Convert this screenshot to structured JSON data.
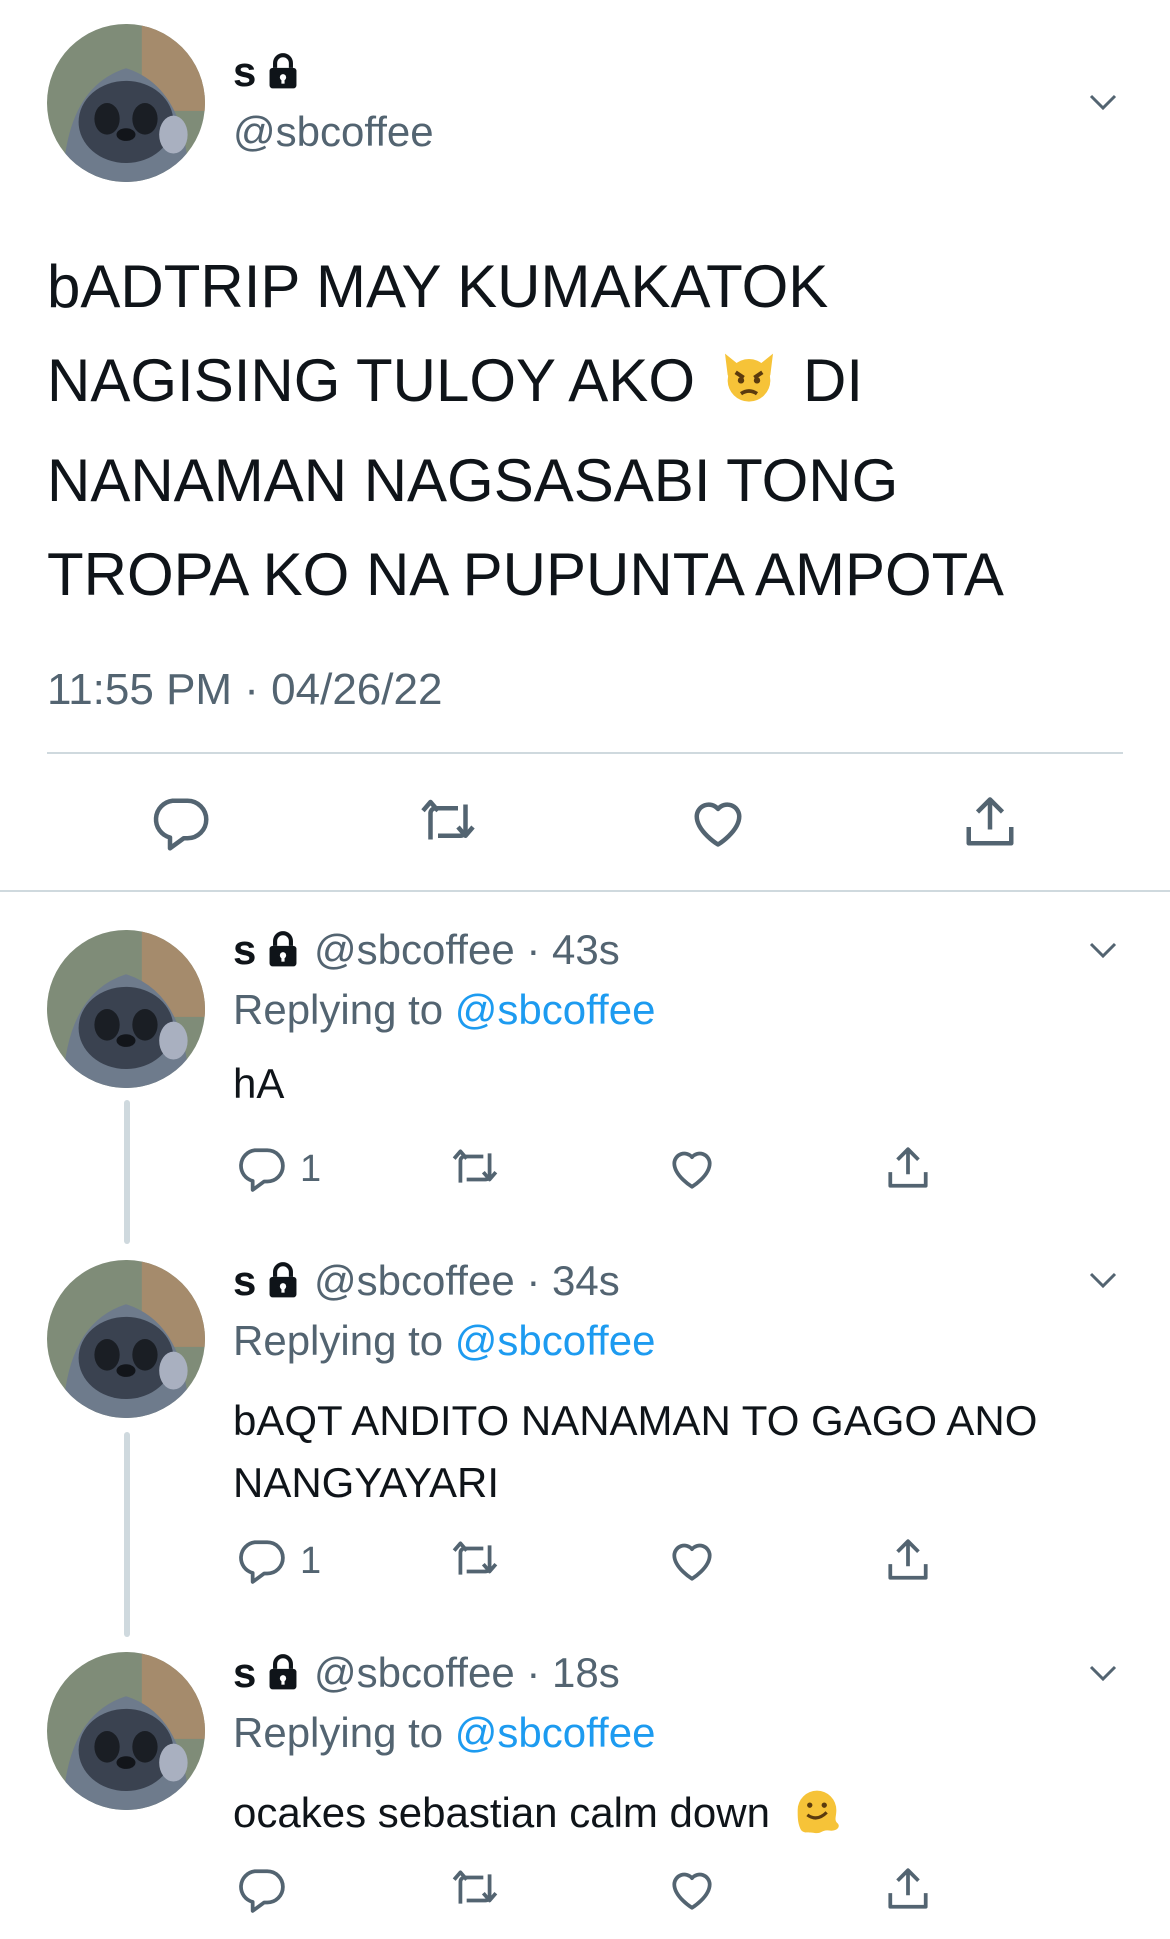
{
  "main_tweet": {
    "display_name": "s",
    "handle": "@sbcoffee",
    "lines": [
      "bADTRIP MAY KUMAKATOK",
      "NAGISING TULOY AKO",
      "DI",
      "NANAMAN NAGSASABI TONG",
      "TROPA KO NA PUPUNTA AMPOTA"
    ],
    "emoji_icon": "pouting-cat-emoji",
    "timestamp": "11:55 PM · 04/26/22"
  },
  "replies": [
    {
      "display_name": "s",
      "handle": "@sbcoffee",
      "time": "· 43s",
      "replying_label": "Replying to",
      "replying_handle": "@sbcoffee",
      "text_lines": [
        "hA"
      ],
      "reply_count": "1"
    },
    {
      "display_name": "s",
      "handle": "@sbcoffee",
      "time": "· 34s",
      "replying_label": "Replying to",
      "replying_handle": "@sbcoffee",
      "text_lines": [
        "bAQT ANDITO NANAMAN TO GAGO ANO",
        "NANGYAYARI"
      ],
      "reply_count": "1"
    },
    {
      "display_name": "s",
      "handle": "@sbcoffee",
      "time": "· 18s",
      "replying_label": "Replying to",
      "replying_handle": "@sbcoffee",
      "text_lines": [
        "ocakes sebastian calm down"
      ],
      "emoji_icon": "melting-face-emoji",
      "reply_count": ""
    }
  ],
  "colors": {
    "text": "#0f1419",
    "secondary": "#536471",
    "link": "#1d9bf0",
    "divider": "#cfd9de"
  }
}
